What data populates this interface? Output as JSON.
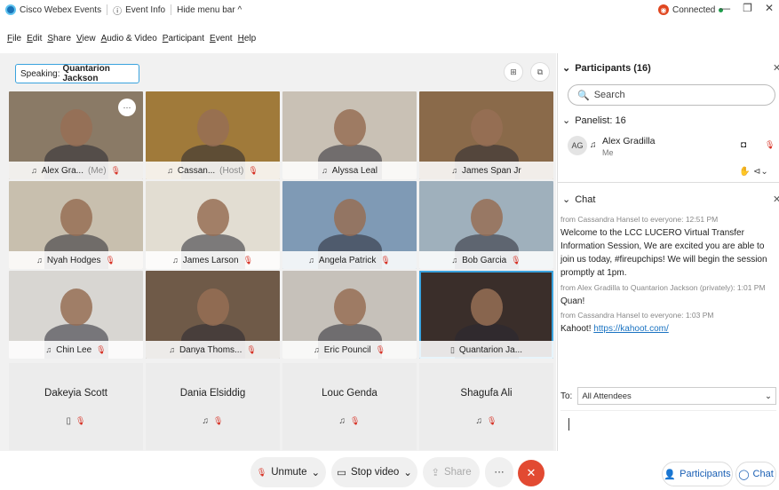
{
  "titlebar": {
    "app_name": "Cisco Webex Events",
    "event_info": "Event Info",
    "hide_menu": "Hide menu bar ^",
    "connected": "Connected"
  },
  "menu": [
    "File",
    "Edit",
    "Share",
    "View",
    "Audio & Video",
    "Participant",
    "Event",
    "Help"
  ],
  "speaking": {
    "label": "Speaking:",
    "name": "Quantarion Jackson"
  },
  "tiles": [
    {
      "name": "Alex Gra...",
      "suffix": "(Me)",
      "bg": "#8a7a66"
    },
    {
      "name": "Cassan...",
      "suffix": "(Host)",
      "bg": "#a07a3a"
    },
    {
      "name": "Alyssa Leal",
      "suffix": "",
      "bg": "#c9c1b5"
    },
    {
      "name": "James Span Jr",
      "suffix": "",
      "bg": "#8a6a4a"
    },
    {
      "name": "Nyah Hodges",
      "suffix": "",
      "bg": "#c8bfae"
    },
    {
      "name": "James Larson",
      "suffix": "",
      "bg": "#e2ddd2"
    },
    {
      "name": "Angela Patrick",
      "suffix": "",
      "bg": "#7f9ab5"
    },
    {
      "name": "Bob Garcia",
      "suffix": "",
      "bg": "#9fb0bc"
    },
    {
      "name": "Chin Lee",
      "suffix": "",
      "bg": "#d8d6d2"
    },
    {
      "name": "Danya Thoms...",
      "suffix": "",
      "bg": "#6f5a48"
    },
    {
      "name": "Eric Pouncil",
      "suffix": "",
      "bg": "#c6c1ba"
    },
    {
      "name": "Quantarion Ja...",
      "suffix": "",
      "bg": "#3a2e2a"
    }
  ],
  "novideo": [
    "Dakeyia Scott",
    "Dania Elsiddig",
    "Louc Genda",
    "Shagufa Ali"
  ],
  "controls": {
    "unmute": "Unmute",
    "stop_video": "Stop video",
    "share": "Share",
    "participants": "Participants",
    "chat": "Chat"
  },
  "participants_panel": {
    "title": "Participants (16)",
    "search_placeholder": "Search",
    "panelist_header": "Panelist: 16",
    "me_initials": "AG",
    "me_name": "Alex Gradilla",
    "me_sub": "Me"
  },
  "chat_panel": {
    "title": "Chat",
    "messages": [
      {
        "meta": "from Cassandra Hansel to everyone:",
        "time": "12:51 PM",
        "text": "Welcome to the LCC LUCERO Virtual Transfer Information Session, We are excited you are able to join us today, #fireupchips! We will begin the session promptly at 1pm."
      },
      {
        "meta": "from Alex Gradilla to Quantarion Jackson (privately):",
        "time": "1:01 PM",
        "text": "Quan!"
      },
      {
        "meta": "from Cassandra Hansel to everyone:",
        "time": "1:03 PM",
        "text": "Kahoot!",
        "link": "https://kahoot.com/"
      }
    ],
    "to_label": "To:",
    "to_value": "All Attendees"
  }
}
